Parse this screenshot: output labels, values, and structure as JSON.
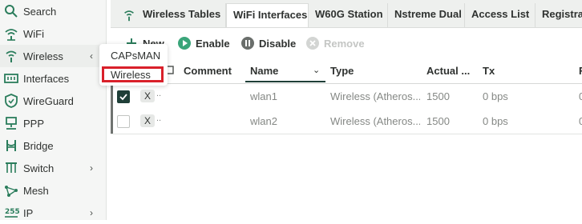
{
  "sidebar": {
    "items": [
      {
        "label": "Search",
        "icon": "search-icon"
      },
      {
        "label": "WiFi",
        "icon": "wifi-icon"
      },
      {
        "label": "Wireless",
        "icon": "wireless-icon",
        "chevron": "‹"
      },
      {
        "label": "Interfaces",
        "icon": "interfaces-icon"
      },
      {
        "label": "WireGuard",
        "icon": "shield-icon"
      },
      {
        "label": "PPP",
        "icon": "ppp-icon"
      },
      {
        "label": "Bridge",
        "icon": "bridge-icon"
      },
      {
        "label": "Switch",
        "icon": "switch-icon",
        "chevron": "›"
      },
      {
        "label": "Mesh",
        "icon": "mesh-icon"
      },
      {
        "label": "IP",
        "icon": "ip-icon",
        "chevron": "›"
      }
    ]
  },
  "submenu": {
    "items": [
      "CAPsMAN",
      "Wireless"
    ]
  },
  "tabs": [
    {
      "label": "Wireless Tables"
    },
    {
      "label": "WiFi Interfaces"
    },
    {
      "label": "W60G Station"
    },
    {
      "label": "Nstreme Dual"
    },
    {
      "label": "Access List"
    },
    {
      "label": "Registrati"
    }
  ],
  "toolbar": {
    "new_label": "New",
    "enable_label": "Enable",
    "disable_label": "Disable",
    "remove_label": "Remove"
  },
  "grid": {
    "columns": [
      "Comment",
      "Name",
      "Type",
      "Actual ...",
      "Tx",
      "R"
    ],
    "rows": [
      {
        "flag": "X",
        "dots": "..",
        "name": "wlan1",
        "type": "Wireless (Atheros...",
        "actual": "1500",
        "tx": "0 bps",
        "r": "0",
        "checked": true
      },
      {
        "flag": "X",
        "dots": "..",
        "name": "wlan2",
        "type": "Wireless (Atheros...",
        "actual": "1500",
        "tx": "0 bps",
        "r": "0",
        "checked": false
      }
    ]
  },
  "colors": {
    "accent_green": "#3aa57a",
    "highlight_red": "#d9202a",
    "checkbox_dark": "#1f3f38"
  }
}
